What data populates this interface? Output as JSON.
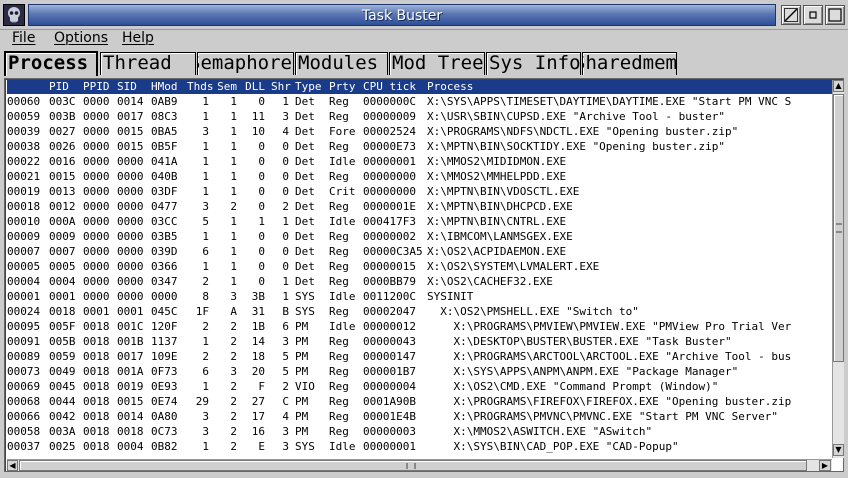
{
  "window": {
    "title": "Task Buster"
  },
  "menubar": {
    "items": [
      {
        "first": "F",
        "rest": "ile"
      },
      {
        "first": "O",
        "rest": "ptions"
      },
      {
        "first": "H",
        "rest": "elp"
      }
    ]
  },
  "tabs": [
    {
      "label": "Process",
      "active": true
    },
    {
      "label": " Thread",
      "active": false
    },
    {
      "label": "Semaphore",
      "active": false
    },
    {
      "label": "Modules",
      "active": false
    },
    {
      "label": "Mod Tree",
      "active": false
    },
    {
      "label": "Sys Info",
      "active": false
    },
    {
      "label": "Sharedmem",
      "active": false
    }
  ],
  "table": {
    "columns": [
      "PID",
      "PPID",
      "SID",
      "HMod",
      "Thds",
      "Sem",
      "DLL",
      "Shr",
      "Type",
      "Prty",
      "CPU tick",
      "Process"
    ],
    "rows": [
      [
        "00060",
        "003C",
        "0000",
        "0014",
        "0AB9",
        "1",
        "1",
        "0",
        "1",
        "Det",
        "Reg",
        "0000000C",
        "X:\\SYS\\APPS\\TIMESET\\DAYTIME\\DAYTIME.EXE \"Start PM VNC S"
      ],
      [
        "00059",
        "003B",
        "0000",
        "0017",
        "08C3",
        "1",
        "1",
        "11",
        "3",
        "Det",
        "Reg",
        "00000009",
        "X:\\USR\\SBIN\\CUPSD.EXE \"Archive Tool - buster\""
      ],
      [
        "00039",
        "0027",
        "0000",
        "0015",
        "0BA5",
        "3",
        "1",
        "10",
        "4",
        "Det",
        "Fore",
        "00002524",
        "X:\\PROGRAMS\\NDFS\\NDCTL.EXE \"Opening buster.zip\""
      ],
      [
        "00038",
        "0026",
        "0000",
        "0015",
        "0B5F",
        "1",
        "1",
        "0",
        "0",
        "Det",
        "Reg",
        "00000E73",
        "X:\\MPTN\\BIN\\SOCKTIDY.EXE \"Opening buster.zip\""
      ],
      [
        "00022",
        "0016",
        "0000",
        "0000",
        "041A",
        "1",
        "1",
        "0",
        "0",
        "Det",
        "Idle",
        "00000001",
        "X:\\MMOS2\\MIDIDMON.EXE"
      ],
      [
        "00021",
        "0015",
        "0000",
        "0000",
        "040B",
        "1",
        "1",
        "0",
        "0",
        "Det",
        "Reg",
        "00000000",
        "X:\\MMOS2\\MMHELPDD.EXE"
      ],
      [
        "00019",
        "0013",
        "0000",
        "0000",
        "03DF",
        "1",
        "1",
        "0",
        "0",
        "Det",
        "Crit",
        "00000000",
        "X:\\MPTN\\BIN\\VDOSCTL.EXE"
      ],
      [
        "00018",
        "0012",
        "0000",
        "0000",
        "0477",
        "3",
        "2",
        "0",
        "2",
        "Det",
        "Reg",
        "0000001E",
        "X:\\MPTN\\BIN\\DHCPCD.EXE"
      ],
      [
        "00010",
        "000A",
        "0000",
        "0000",
        "03CC",
        "5",
        "1",
        "1",
        "1",
        "Det",
        "Idle",
        "000417F3",
        "X:\\MPTN\\BIN\\CNTRL.EXE"
      ],
      [
        "00009",
        "0009",
        "0000",
        "0000",
        "03B5",
        "1",
        "1",
        "0",
        "0",
        "Det",
        "Reg",
        "00000002",
        "X:\\IBMCOM\\LANMSGEX.EXE"
      ],
      [
        "00007",
        "0007",
        "0000",
        "0000",
        "039D",
        "6",
        "1",
        "0",
        "0",
        "Det",
        "Reg",
        "00000C3A5",
        "X:\\OS2\\ACPIDAEMON.EXE"
      ],
      [
        "00005",
        "0005",
        "0000",
        "0000",
        "0366",
        "1",
        "1",
        "0",
        "0",
        "Det",
        "Reg",
        "00000015",
        "X:\\OS2\\SYSTEM\\LVMALERT.EXE"
      ],
      [
        "00004",
        "0004",
        "0000",
        "0000",
        "0347",
        "2",
        "1",
        "0",
        "1",
        "Det",
        "Reg",
        "0000BB79",
        "X:\\OS2\\CACHEF32.EXE"
      ],
      [
        "00001",
        "0001",
        "0000",
        "0000",
        "0000",
        "8",
        "3",
        "3B",
        "1",
        "SYS",
        "Idle",
        "0011200C",
        "SYSINIT"
      ],
      [
        "00024",
        "0018",
        "0001",
        "0001",
        "045C",
        "1F",
        "A",
        "31",
        "B",
        "SYS",
        "Reg",
        "00002047",
        "  X:\\OS2\\PMSHELL.EXE \"Switch to\""
      ],
      [
        "00095",
        "005F",
        "0018",
        "001C",
        "120F",
        "2",
        "2",
        "1B",
        "6",
        "PM",
        "Idle",
        "00000012",
        "    X:\\PROGRAMS\\PMVIEW\\PMVIEW.EXE \"PMView Pro Trial Ver"
      ],
      [
        "00091",
        "005B",
        "0018",
        "001B",
        "1137",
        "1",
        "2",
        "14",
        "3",
        "PM",
        "Reg",
        "00000043",
        "    X:\\DESKTOP\\BUSTER\\BUSTER.EXE \"Task Buster\""
      ],
      [
        "00089",
        "0059",
        "0018",
        "0017",
        "109E",
        "2",
        "2",
        "18",
        "5",
        "PM",
        "Reg",
        "00000147",
        "    X:\\PROGRAMS\\ARCTOOL\\ARCTOOL.EXE \"Archive Tool - bus"
      ],
      [
        "00073",
        "0049",
        "0018",
        "001A",
        "0F73",
        "6",
        "3",
        "20",
        "5",
        "PM",
        "Reg",
        "000001B7",
        "    X:\\SYS\\APPS\\ANPM\\ANPM.EXE \"Package Manager\""
      ],
      [
        "00069",
        "0045",
        "0018",
        "0019",
        "0E93",
        "1",
        "2",
        "F",
        "2",
        "VIO",
        "Reg",
        "00000004",
        "    X:\\OS2\\CMD.EXE \"Command Prompt (Window)\""
      ],
      [
        "00068",
        "0044",
        "0018",
        "0015",
        "0E74",
        "29",
        "2",
        "27",
        "C",
        "PM",
        "Reg",
        "0001A90B",
        "    X:\\PROGRAMS\\FIREFOX\\FIREFOX.EXE \"Opening buster.zip"
      ],
      [
        "00066",
        "0042",
        "0018",
        "0014",
        "0A80",
        "3",
        "2",
        "17",
        "4",
        "PM",
        "Reg",
        "00001E4B",
        "    X:\\PROGRAMS\\PMVNC\\PMVNC.EXE \"Start PM VNC Server\""
      ],
      [
        "00058",
        "003A",
        "0018",
        "0018",
        "0C73",
        "3",
        "2",
        "16",
        "3",
        "PM",
        "Reg",
        "00000003",
        "    X:\\MMOS2\\ASWITCH.EXE \"ASwitch\""
      ],
      [
        "00037",
        "0025",
        "0018",
        "0004",
        "0B82",
        "1",
        "2",
        "E",
        "3",
        "SYS",
        "Idle",
        "00000001",
        "    X:\\SYS\\BIN\\CAD_POP.EXE \"CAD-Popup\""
      ]
    ]
  }
}
